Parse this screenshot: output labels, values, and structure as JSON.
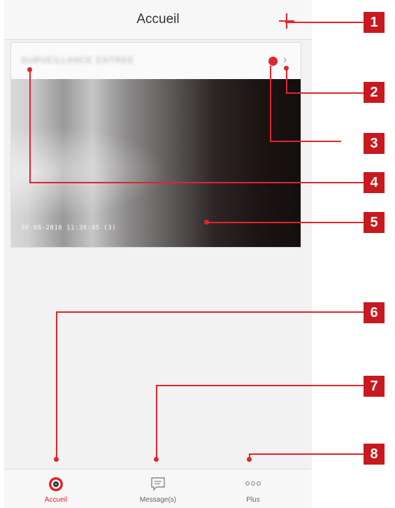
{
  "header": {
    "title": "Accueil",
    "add_icon": "plus-icon"
  },
  "device": {
    "name": "SURVEILLANCE ENTREE",
    "preview_timestamp": "30-08-2018  11:30:45   (3)",
    "status_color": "#e0252b"
  },
  "tabs": [
    {
      "label": "Accueil",
      "icon": "camera-icon",
      "active": true
    },
    {
      "label": "Message(s)",
      "icon": "message-icon",
      "active": false
    },
    {
      "label": "Plus",
      "icon": "more-icon",
      "active": false
    }
  ],
  "callouts": [
    "1",
    "2",
    "3",
    "4",
    "5",
    "6",
    "7",
    "8"
  ],
  "colors": {
    "accent": "#e0252b",
    "callout": "#c8191f"
  }
}
